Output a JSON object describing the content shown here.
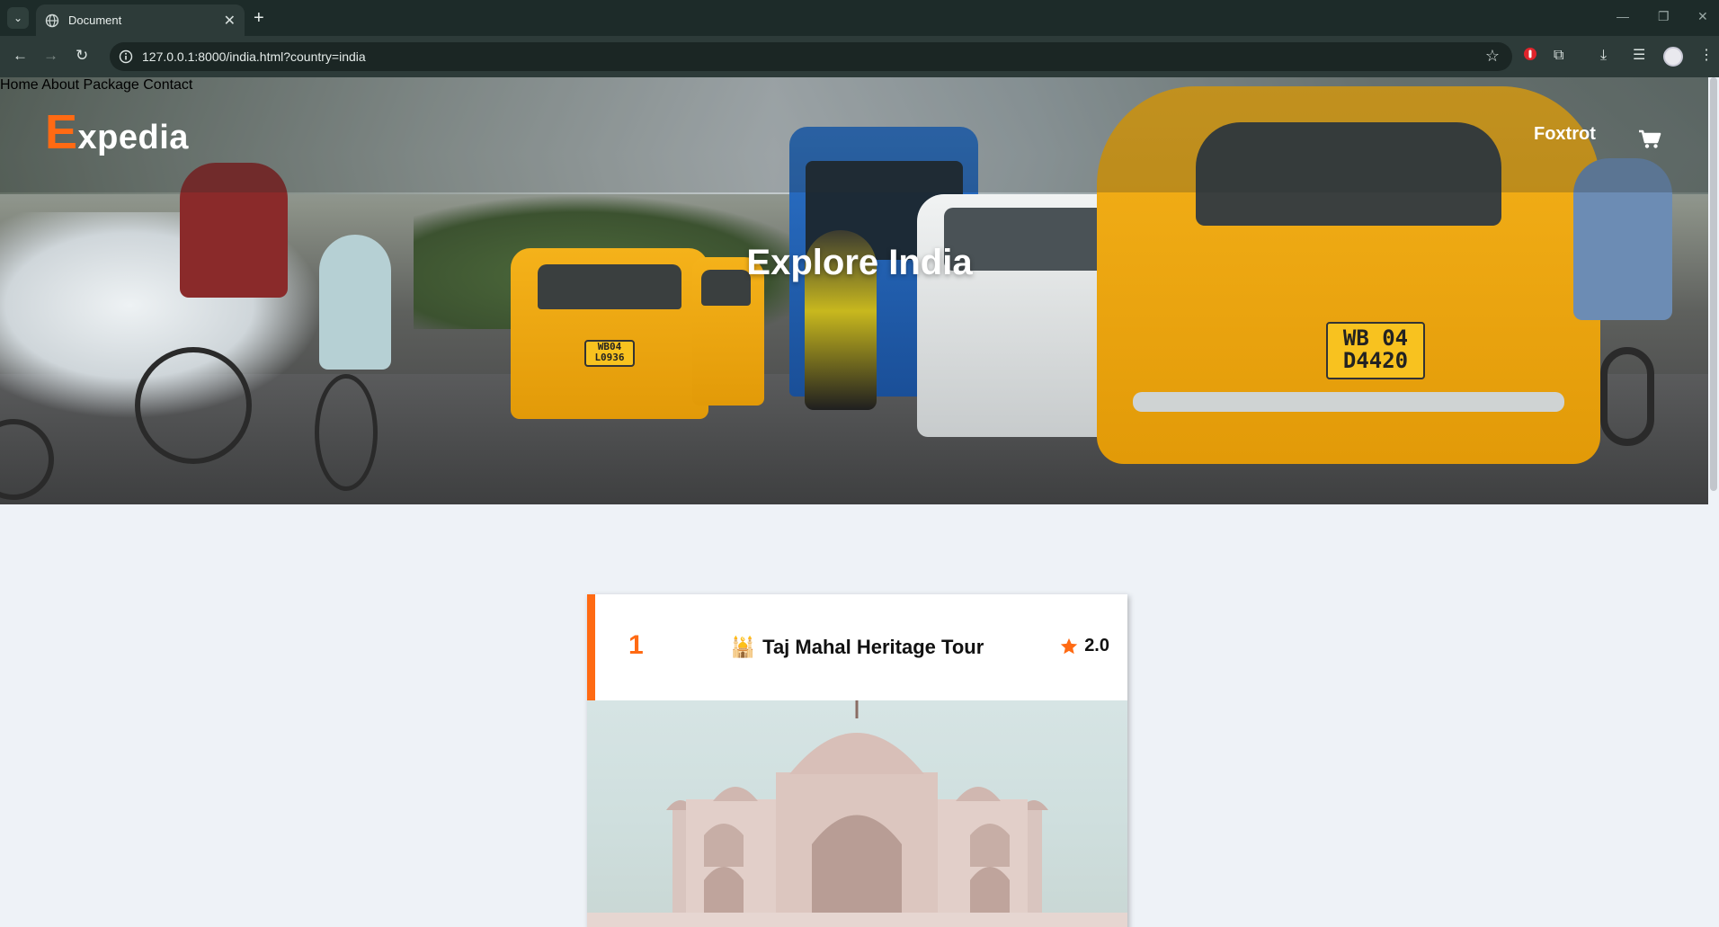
{
  "browser": {
    "tab_title": "Document",
    "url": "127.0.0.1:8000/india.html?country=india"
  },
  "site": {
    "logo_first_letter": "E",
    "logo_rest": "xpedia",
    "nav": [
      {
        "label": "Home"
      },
      {
        "label": "About"
      },
      {
        "label": "Package"
      },
      {
        "label": "Contact"
      }
    ],
    "user_name": "Foxtrot",
    "hero_title": "Explore India",
    "accent_color": "#ff6a13"
  },
  "tours": [
    {
      "number": "1",
      "icon": "🕌",
      "name": "Taj Mahal Heritage Tour",
      "rating": "2.0"
    }
  ],
  "hero_plates": {
    "big": [
      "WB 04",
      "D4420"
    ],
    "small": [
      "WB04",
      "L0936"
    ]
  }
}
